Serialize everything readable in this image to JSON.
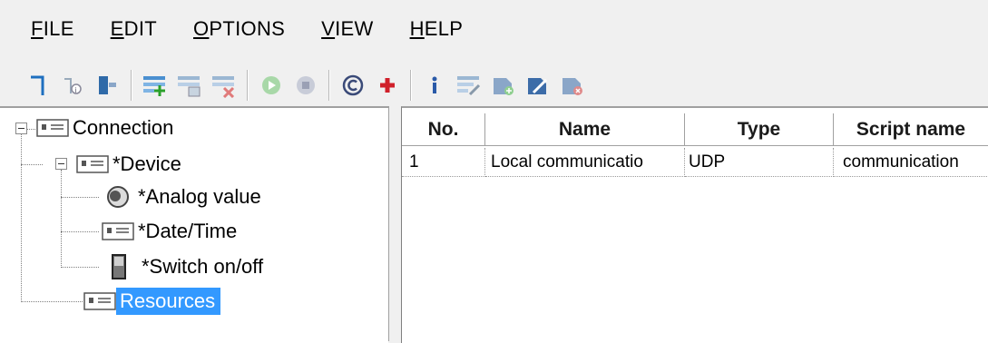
{
  "menu": {
    "items": [
      {
        "key": "F",
        "rest": "ILE"
      },
      {
        "key": "E",
        "rest": "DIT"
      },
      {
        "key": "O",
        "rest": "PTIONS"
      },
      {
        "key": "V",
        "rest": "IEW"
      },
      {
        "key": "H",
        "rest": "ELP"
      }
    ]
  },
  "toolbar": {
    "icons": [
      "new-icon",
      "properties-icon",
      "import-icon",
      "add-row-icon",
      "copy-row-icon",
      "delete-row-icon",
      "start-icon",
      "stop-icon",
      "copyright-icon",
      "add-icon",
      "info-icon",
      "edit-list-icon",
      "add-item-icon",
      "edit-item-icon",
      "remove-item-icon"
    ]
  },
  "tree": {
    "nodes": [
      {
        "label": "Connection",
        "icon": "connection-icon"
      },
      {
        "label": "*Device",
        "icon": "device-icon"
      },
      {
        "label": "*Analog value",
        "icon": "analog-value-icon"
      },
      {
        "label": "*Date/Time",
        "icon": "datetime-icon"
      },
      {
        "label": "*Switch on/off",
        "icon": "switch-icon"
      },
      {
        "label": "Resources",
        "icon": "resources-icon",
        "selected": true
      }
    ]
  },
  "table": {
    "columns": [
      "No.",
      "Name",
      "Type",
      "Script name"
    ],
    "rows": [
      [
        "1",
        "Local communicatio",
        "UDP",
        "communication"
      ]
    ]
  },
  "colors": {
    "selection": "#3399ff",
    "background": "#f0f0f0"
  }
}
